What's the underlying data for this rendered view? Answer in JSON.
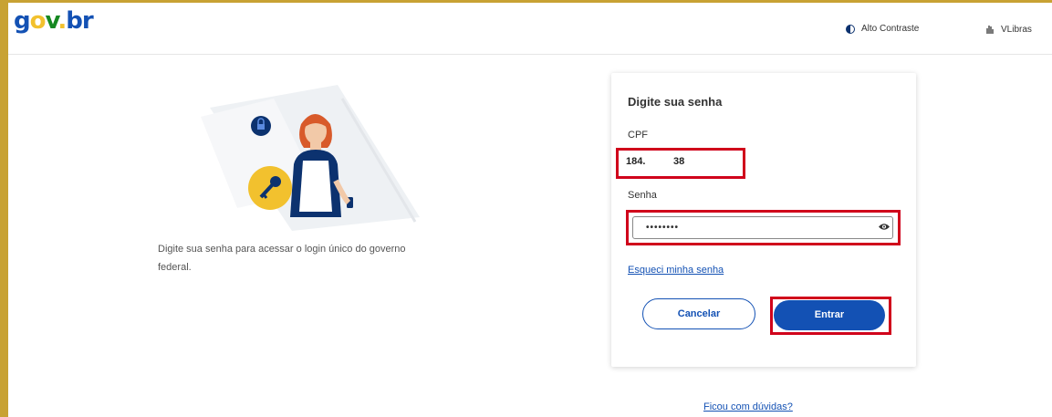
{
  "header": {
    "logo": {
      "g": "g",
      "o": "o",
      "v": "v",
      "dot": ".",
      "b": "b",
      "r": "r"
    },
    "high_contrast": "Alto Contraste",
    "vlibras": "VLibras"
  },
  "left": {
    "intro": "Digite sua senha para acessar o login único do governo federal."
  },
  "form": {
    "title": "Digite sua senha",
    "cpf_label": "CPF",
    "cpf_value": "184.          38",
    "password_label": "Senha",
    "password_value": "••••••••",
    "forgot": "Esqueci minha senha",
    "cancel": "Cancelar",
    "enter": "Entrar"
  },
  "footer": {
    "help": "Ficou com dúvidas?"
  },
  "colors": {
    "brand_blue": "#1351b4",
    "highlight_red": "#d0021b",
    "frame_gold": "#c8a233"
  },
  "icons": {
    "contrast": "contrast-icon",
    "libras": "hand-icon",
    "eye": "eye-icon",
    "key": "key-icon",
    "lock": "lock-icon"
  }
}
